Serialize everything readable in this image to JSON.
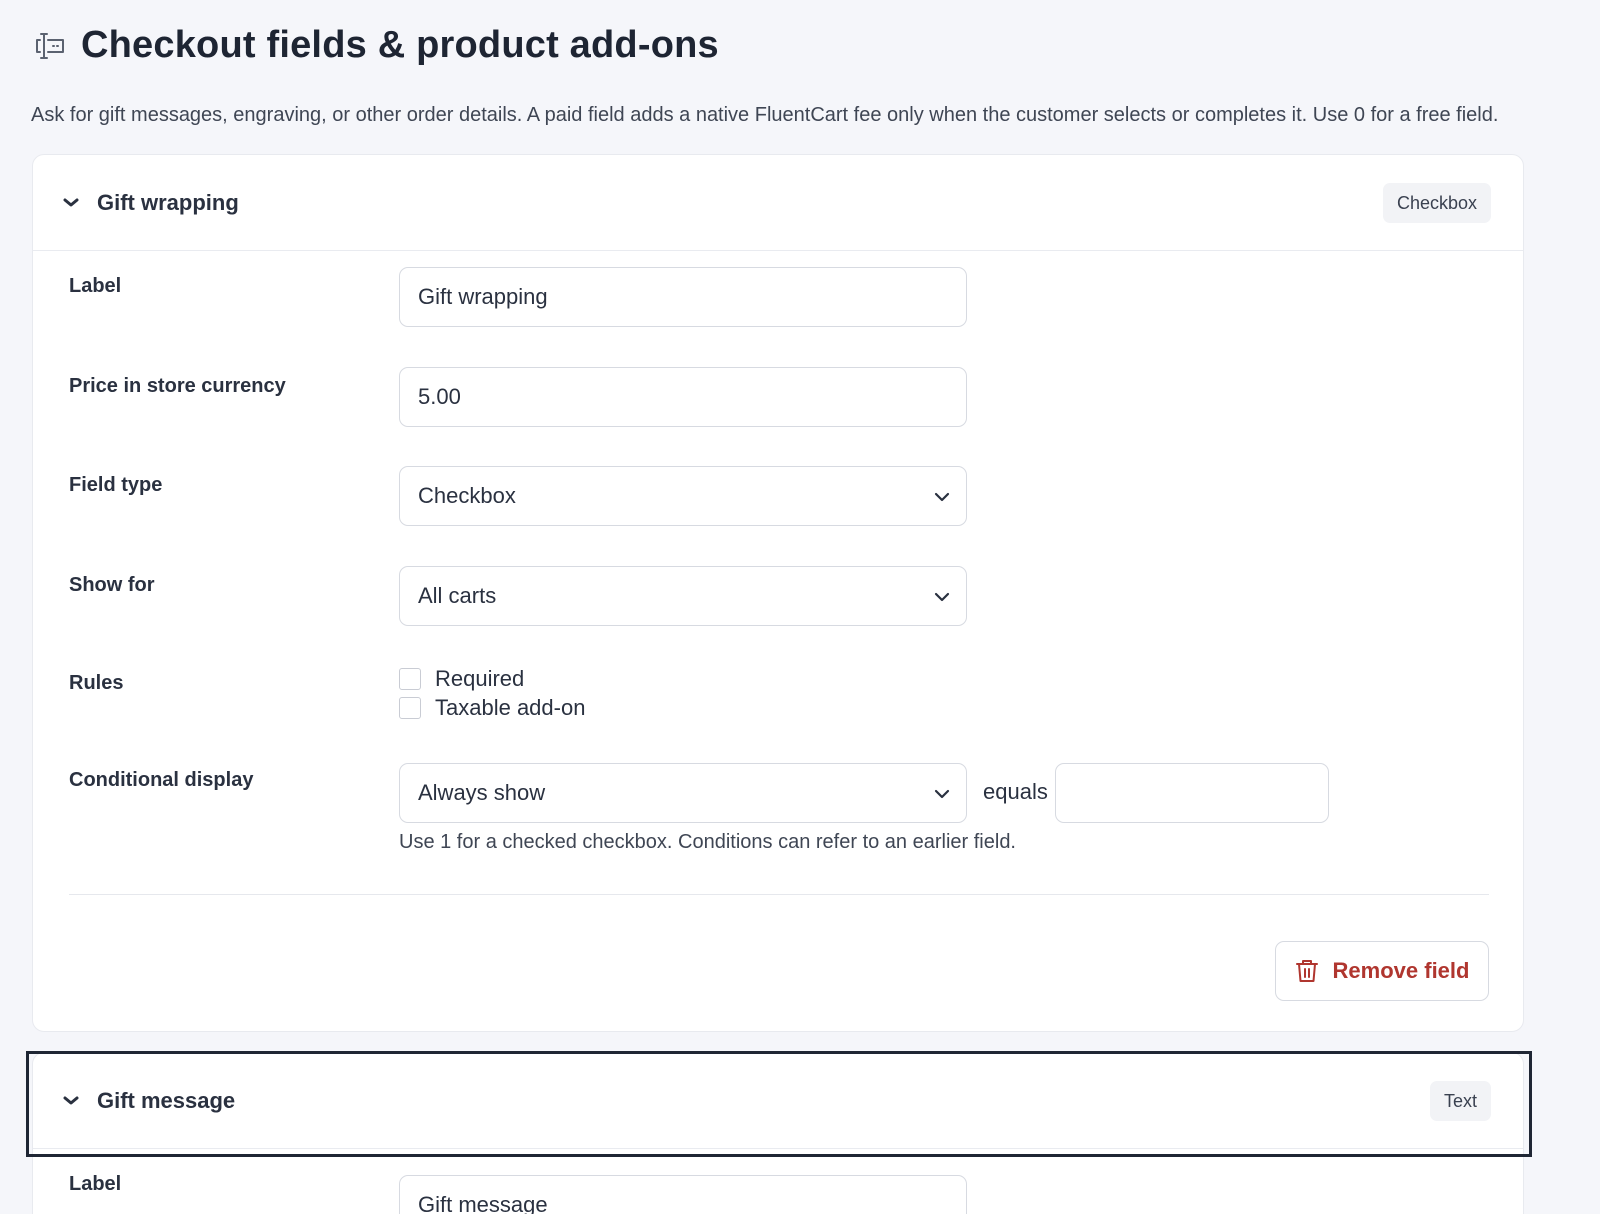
{
  "header": {
    "icon": "form-fields-icon",
    "title": "Checkout fields & product add-ons"
  },
  "description": "Ask for gift messages, engraving, or other order details. A paid field adds a native FluentCart fee only when the customer selects or completes it. Use 0 for a free field.",
  "fields": [
    {
      "title": "Gift wrapping",
      "type_badge": "Checkbox",
      "label_label": "Label",
      "label_value": "Gift wrapping",
      "price_label": "Price in store currency",
      "price_value": "5.00",
      "type_label": "Field type",
      "type_value": "Checkbox",
      "show_for_label": "Show for",
      "show_for_value": "All carts",
      "rules_label": "Rules",
      "rules": [
        {
          "label": "Required",
          "checked": false
        },
        {
          "label": "Taxable add-on",
          "checked": false
        }
      ],
      "conditional_label": "Conditional display",
      "conditional_value": "Always show",
      "equals_text": "equals",
      "equals_value": "",
      "help_text": "Use 1 for a checked checkbox. Conditions can refer to an earlier field.",
      "remove_label": "Remove field"
    },
    {
      "title": "Gift message",
      "type_badge": "Text",
      "label_label": "Label",
      "label_value": "Gift message"
    }
  ],
  "colors": {
    "background": "#f5f6fa",
    "card": "#ffffff",
    "danger": "#b0362f",
    "focus_ring": "#1f2634"
  }
}
